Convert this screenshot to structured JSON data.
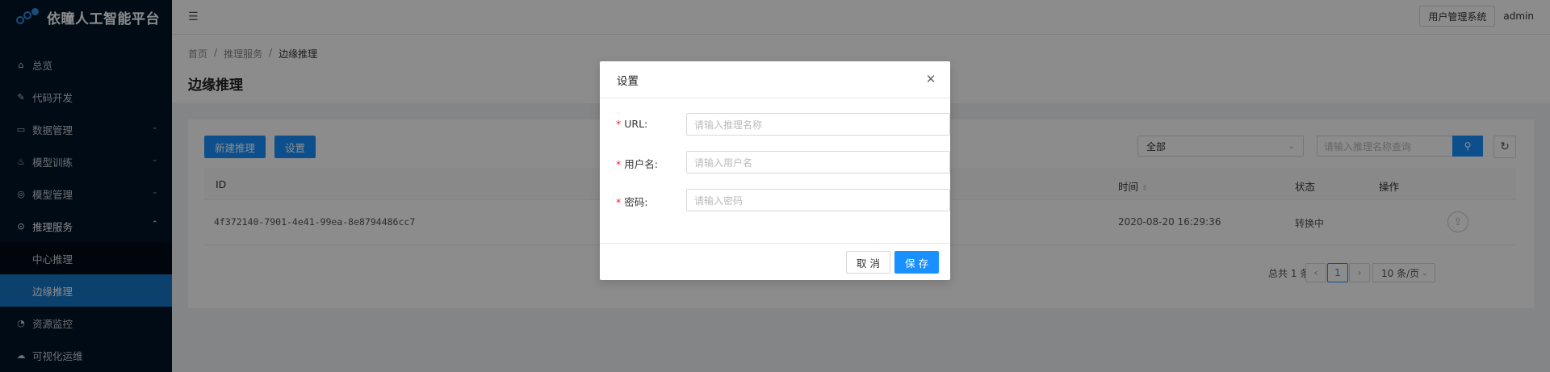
{
  "app": {
    "title": "依瞳人工智能平台"
  },
  "sidebar": {
    "items": [
      {
        "label": "总览",
        "icon": "home-icon"
      },
      {
        "label": "代码开发",
        "icon": "edit-icon"
      },
      {
        "label": "数据管理",
        "icon": "database-icon",
        "expandable": true
      },
      {
        "label": "模型训练",
        "icon": "fire-icon",
        "expandable": true
      },
      {
        "label": "模型管理",
        "icon": "model-icon",
        "expandable": true
      },
      {
        "label": "推理服务",
        "icon": "location-icon",
        "expandable": true,
        "expanded": true
      },
      {
        "label": "资源监控",
        "icon": "dashboard-icon"
      },
      {
        "label": "可视化运维",
        "icon": "cloud-icon"
      }
    ],
    "subitems": [
      {
        "label": "中心推理",
        "active": false
      },
      {
        "label": "边缘推理",
        "active": true
      }
    ]
  },
  "header": {
    "system_button": "用户管理系统",
    "user": "admin"
  },
  "breadcrumb": {
    "items": [
      "首页",
      "推理服务",
      "边缘推理"
    ],
    "separator": "/"
  },
  "page": {
    "title": "边缘推理"
  },
  "toolbar": {
    "new_button": "新建推理",
    "settings_button": "设置",
    "filter_value": "全部",
    "search_placeholder": "请输入推理名称查询"
  },
  "table": {
    "columns": [
      "ID",
      "时间",
      "状态",
      "操作"
    ],
    "rows": [
      {
        "id": "4f372140-7901-4e41-99ea-8e8794486cc7",
        "time": "2020-08-20 16:29:36",
        "status": "转换中"
      }
    ]
  },
  "pagination": {
    "total_text": "总共 1 条",
    "current_page": "1",
    "page_size": "10 条/页"
  },
  "modal": {
    "title": "设置",
    "fields": [
      {
        "label": "URL:",
        "placeholder": "请输入推理名称",
        "required": true
      },
      {
        "label": "用户名:",
        "placeholder": "请输入用户名",
        "required": true
      },
      {
        "label": "密码:",
        "placeholder": "请输入密码",
        "required": true
      }
    ],
    "cancel_button": "取 消",
    "save_button": "保 存"
  },
  "colors": {
    "sidebar_bg": "#001529",
    "primary": "#1890ff",
    "active_menu": "#1677c8",
    "required": "#f5222d"
  }
}
